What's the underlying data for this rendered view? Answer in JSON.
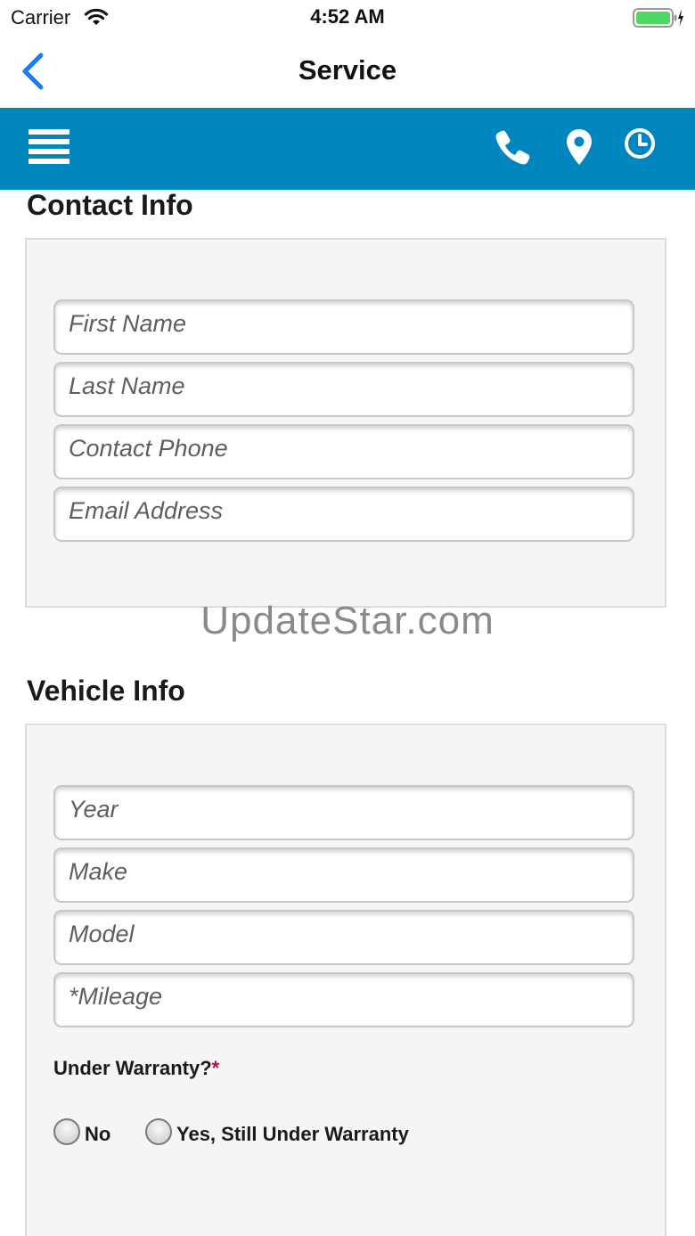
{
  "status_bar": {
    "carrier": "Carrier",
    "time": "4:52 AM"
  },
  "nav": {
    "title": "Service"
  },
  "toolbar": {
    "icons": [
      "menu-icon",
      "phone-icon",
      "location-pin-icon",
      "clock-icon"
    ],
    "background_color": "#0086bf"
  },
  "contact": {
    "title": "Contact Info",
    "fields": [
      {
        "placeholder": "First Name",
        "value": ""
      },
      {
        "placeholder": "Last Name",
        "value": ""
      },
      {
        "placeholder": "Contact Phone",
        "value": ""
      },
      {
        "placeholder": "Email Address",
        "value": ""
      }
    ]
  },
  "watermark": "UpdateStar.com",
  "vehicle": {
    "title": "Vehicle Info",
    "fields": [
      {
        "placeholder": "Year",
        "value": ""
      },
      {
        "placeholder": "Make",
        "value": ""
      },
      {
        "placeholder": "Model",
        "value": ""
      },
      {
        "placeholder": "*Mileage",
        "value": ""
      }
    ],
    "warranty": {
      "label": "Under Warranty?",
      "required_mark": "*",
      "options": [
        {
          "label": "No",
          "selected": false
        },
        {
          "label": "Yes, Still Under Warranty",
          "selected": false
        }
      ]
    }
  },
  "colors": {
    "accent_blue": "#0086bf",
    "ios_blue": "#1a7cf5",
    "battery_green": "#4cd964",
    "required_red": "#c0103a"
  }
}
